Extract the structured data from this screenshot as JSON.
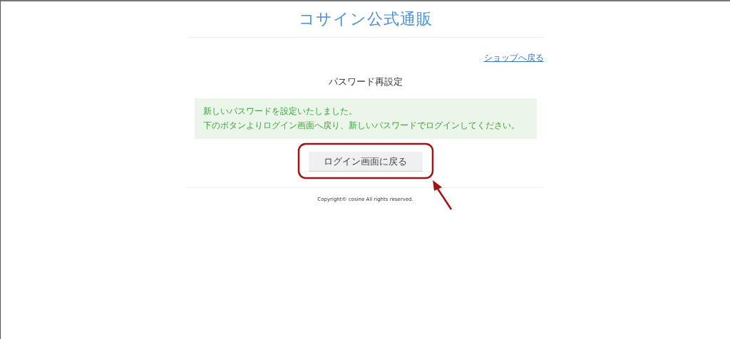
{
  "site_title": "コサイン公式通販",
  "back_link": "ショップへ戻る",
  "heading": "パスワード再設定",
  "message": [
    "新しいパスワードを設定いたしました。",
    "下のボタンよりログイン画面へ戻り、新しいパスワードでログインしてください。"
  ],
  "button": "ログイン画面に戻る",
  "copyright": "Copyright© cosine All rights reserved."
}
